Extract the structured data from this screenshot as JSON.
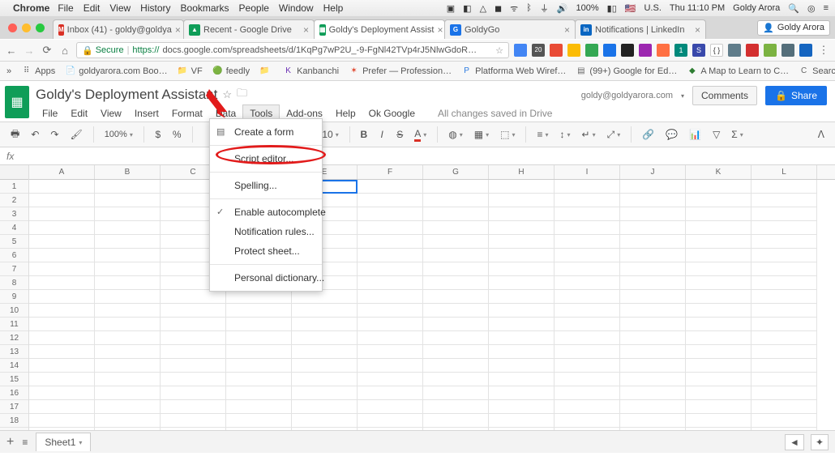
{
  "mac": {
    "app": "Chrome",
    "menus": [
      "File",
      "Edit",
      "View",
      "History",
      "Bookmarks",
      "People",
      "Window",
      "Help"
    ],
    "battery": "100%",
    "locale": "U.S.",
    "flag": "🇺🇸",
    "time": "Thu 11:10 PM",
    "user": "Goldy Arora"
  },
  "chrome": {
    "tabs": [
      {
        "fav": "M",
        "label": "Inbox (41) - goldy@goldya",
        "favcolor": "#d93025"
      },
      {
        "fav": "▲",
        "label": "Recent - Google Drive",
        "favcolor": "#0f9d58"
      },
      {
        "fav": "▦",
        "label": "Goldy's Deployment Assist",
        "favcolor": "#0f9d58",
        "active": true
      },
      {
        "fav": "G",
        "label": "GoldyGo",
        "favcolor": "#1a73e8"
      },
      {
        "fav": "in",
        "label": "Notifications | LinkedIn",
        "favcolor": "#0a66c2"
      }
    ],
    "user_btn": "Goldy Arora",
    "secure": "Secure",
    "url_prefix": "https://",
    "url": "docs.google.com/spreadsheets/d/1KqPg7wP2U_-9-FgNl42TVp4rJ5NlwGdoR…",
    "star": "☆"
  },
  "bookmarks": [
    {
      "ico": "⠿",
      "label": "Apps"
    },
    {
      "ico": "📄",
      "label": "goldyarora.com Boo…"
    },
    {
      "ico": "📁",
      "label": "VF"
    },
    {
      "ico": "🟢",
      "label": "feedly"
    },
    {
      "ico": "📁",
      "label": ""
    },
    {
      "ico": "K",
      "label": "Kanbanchi",
      "icocolor": "#6b2fb3"
    },
    {
      "ico": "✶",
      "label": "Prefer — Profession…",
      "icocolor": "#e0452c"
    },
    {
      "ico": "P",
      "label": "Platforma Web Wiref…",
      "icocolor": "#2c7be0"
    },
    {
      "ico": "▤",
      "label": "(99+) Google for Ed…"
    },
    {
      "ico": "◆",
      "label": "A Map to Learn to C…",
      "icocolor": "#2e7d32"
    },
    {
      "ico": "C",
      "label": "Search results for 'to…"
    }
  ],
  "sheets": {
    "title": "Goldy's Deployment Assistant",
    "email": "goldy@goldyarora.com",
    "comments": "Comments",
    "share": "Share",
    "menus": [
      "File",
      "Edit",
      "View",
      "Insert",
      "Format",
      "Data",
      "Tools",
      "Add-ons",
      "Help",
      "Ok Google"
    ],
    "open_menu_index": 6,
    "changes": "All changes saved in Drive",
    "zoom": "100%",
    "fontsize": "10",
    "tools_menu": [
      {
        "label": "Create a form",
        "ico": "▤"
      },
      {
        "sep": true
      },
      {
        "label": "Script editor...",
        "highlight": true
      },
      {
        "sep": true
      },
      {
        "label": "Spelling..."
      },
      {
        "sep": true
      },
      {
        "label": "Enable autocomplete",
        "ico": "✓"
      },
      {
        "label": "Notification rules..."
      },
      {
        "label": "Protect sheet..."
      },
      {
        "sep": true
      },
      {
        "label": "Personal dictionary..."
      }
    ],
    "columns": [
      "A",
      "B",
      "C",
      "D",
      "E",
      "F",
      "G",
      "H",
      "I",
      "J",
      "K",
      "L"
    ],
    "rows": 19,
    "active_cell": {
      "row": 0,
      "col": 4
    },
    "sheet_tab": "Sheet1"
  }
}
